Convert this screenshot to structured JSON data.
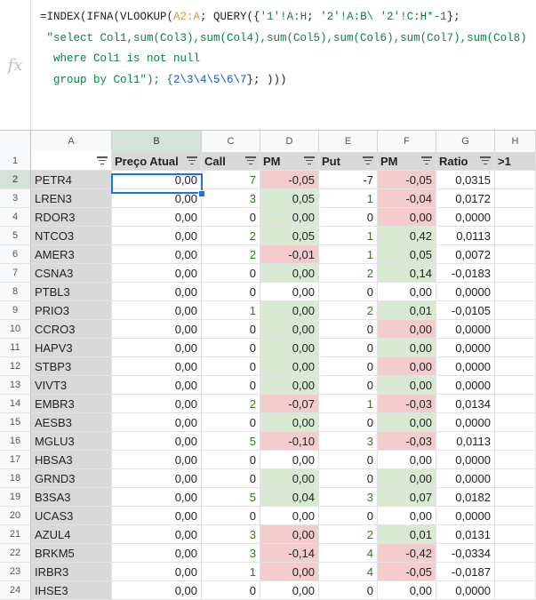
{
  "formula_bar": {
    "fx_label": "fx",
    "line1_a": "=INDEX(IFNA(VLOOKUP(",
    "line1_ref": "A2:A",
    "line1_b": "; QUERY({",
    "line1_s1": "'1'!A:H",
    "line1_c": "; ",
    "line1_s2": "'2'!A:B\\ '2'!C:H*-1",
    "line1_d": "};",
    "line2": " \"select Col1,sum(Col3),sum(Col4),sum(Col5),sum(Col6),sum(Col7),sum(Col8)",
    "line3": "  where Col1 is not null",
    "line4_a": "  group by Col1\"); {",
    "line4_nums": "2\\3\\4\\5\\6\\7",
    "line4_b": "}; )))"
  },
  "column_headers": [
    "A",
    "B",
    "C",
    "D",
    "E",
    "F",
    "G",
    "H"
  ],
  "header_row": {
    "row_number": "1",
    "labels": [
      "",
      "Preço Atual",
      "Call",
      "PM",
      "Put",
      "PM",
      "Ratio",
      ">1"
    ]
  },
  "rows": [
    {
      "n": "2",
      "ticker": "PETR4",
      "preco": "0,00",
      "call": "7",
      "pm1": "-0,05",
      "put": "-7",
      "pm2": "-0,05",
      "ratio": "0,0315"
    },
    {
      "n": "3",
      "ticker": "LREN3",
      "preco": "0,00",
      "call": "3",
      "pm1": "0,05",
      "put": "1",
      "pm2": "-0,04",
      "ratio": "0,0172"
    },
    {
      "n": "4",
      "ticker": "RDOR3",
      "preco": "0,00",
      "call": "0",
      "pm1": "0,00",
      "put": "0",
      "pm2": "0,00",
      "ratio": "0,0000"
    },
    {
      "n": "5",
      "ticker": "NTCO3",
      "preco": "0,00",
      "call": "2",
      "pm1": "0,05",
      "put": "1",
      "pm2": "0,42",
      "ratio": "0,0113"
    },
    {
      "n": "6",
      "ticker": "AMER3",
      "preco": "0,00",
      "call": "2",
      "pm1": "-0,01",
      "put": "1",
      "pm2": "0,05",
      "ratio": "0,0072"
    },
    {
      "n": "7",
      "ticker": "CSNA3",
      "preco": "0,00",
      "call": "0",
      "pm1": "0,00",
      "put": "2",
      "pm2": "0,14",
      "ratio": "-0,0183"
    },
    {
      "n": "8",
      "ticker": "PTBL3",
      "preco": "0,00",
      "call": "0",
      "pm1": "0,00",
      "put": "0",
      "pm2": "0,00",
      "ratio": "0,0000"
    },
    {
      "n": "9",
      "ticker": "PRIO3",
      "preco": "0,00",
      "call": "1",
      "pm1": "0,00",
      "put": "2",
      "pm2": "0,01",
      "ratio": "-0,0105"
    },
    {
      "n": "10",
      "ticker": "CCRO3",
      "preco": "0,00",
      "call": "0",
      "pm1": "0,00",
      "put": "0",
      "pm2": "0,00",
      "ratio": "0,0000"
    },
    {
      "n": "11",
      "ticker": "HAPV3",
      "preco": "0,00",
      "call": "0",
      "pm1": "0,00",
      "put": "0",
      "pm2": "0,00",
      "ratio": "0,0000"
    },
    {
      "n": "12",
      "ticker": "STBP3",
      "preco": "0,00",
      "call": "0",
      "pm1": "0,00",
      "put": "0",
      "pm2": "0,00",
      "ratio": "0,0000"
    },
    {
      "n": "13",
      "ticker": "VIVT3",
      "preco": "0,00",
      "call": "0",
      "pm1": "0,00",
      "put": "0",
      "pm2": "0,00",
      "ratio": "0,0000"
    },
    {
      "n": "14",
      "ticker": "EMBR3",
      "preco": "0,00",
      "call": "2",
      "pm1": "-0,07",
      "put": "1",
      "pm2": "-0,03",
      "ratio": "0,0134"
    },
    {
      "n": "15",
      "ticker": "AESB3",
      "preco": "0,00",
      "call": "0",
      "pm1": "0,00",
      "put": "0",
      "pm2": "0,00",
      "ratio": "0,0000"
    },
    {
      "n": "16",
      "ticker": "MGLU3",
      "preco": "0,00",
      "call": "5",
      "pm1": "-0,10",
      "put": "3",
      "pm2": "-0,03",
      "ratio": "0,0113"
    },
    {
      "n": "17",
      "ticker": "HBSA3",
      "preco": "0,00",
      "call": "0",
      "pm1": "0,00",
      "put": "0",
      "pm2": "0,00",
      "ratio": "0,0000"
    },
    {
      "n": "18",
      "ticker": "GRND3",
      "preco": "0,00",
      "call": "0",
      "pm1": "0,00",
      "put": "0",
      "pm2": "0,00",
      "ratio": "0,0000"
    },
    {
      "n": "19",
      "ticker": "B3SA3",
      "preco": "0,00",
      "call": "5",
      "pm1": "0,04",
      "put": "3",
      "pm2": "0,07",
      "ratio": "0,0182"
    },
    {
      "n": "20",
      "ticker": "UCAS3",
      "preco": "0,00",
      "call": "0",
      "pm1": "0,00",
      "put": "0",
      "pm2": "0,00",
      "ratio": "0,0000"
    },
    {
      "n": "21",
      "ticker": "AZUL4",
      "preco": "0,00",
      "call": "3",
      "pm1": "0,00",
      "put": "2",
      "pm2": "0,01",
      "ratio": "0,0131"
    },
    {
      "n": "22",
      "ticker": "BRKM5",
      "preco": "0,00",
      "call": "3",
      "pm1": "-0,14",
      "put": "4",
      "pm2": "-0,42",
      "ratio": "-0,0334"
    },
    {
      "n": "23",
      "ticker": "IRBR3",
      "preco": "0,00",
      "call": "1",
      "pm1": "0,00",
      "put": "4",
      "pm2": "-0,05",
      "ratio": "-0,0187"
    },
    {
      "n": "24",
      "ticker": "IHSE3",
      "preco": "0,00",
      "call": "0",
      "pm1": "0,00",
      "put": "0",
      "pm2": "0,00",
      "ratio": "0,0000"
    }
  ],
  "styles": {
    "pm1": [
      "red",
      "green",
      "green",
      "green",
      "red",
      "green",
      "",
      "green",
      "green",
      "green",
      "green",
      "green",
      "red",
      "green",
      "red",
      "",
      "green",
      "green",
      "",
      "red",
      "red",
      "red",
      ""
    ],
    "pm2": [
      "red",
      "red",
      "red",
      "green",
      "green",
      "green",
      "",
      "green",
      "red",
      "green",
      "red",
      "green",
      "red",
      "green",
      "red",
      "",
      "green",
      "green",
      "",
      "green",
      "red",
      "red",
      ""
    ]
  },
  "colors": {
    "red_fill": "#f4cccc",
    "green_fill": "#d9ead3",
    "header_grey": "#d9d9d9",
    "selection": "#1a73e8"
  }
}
